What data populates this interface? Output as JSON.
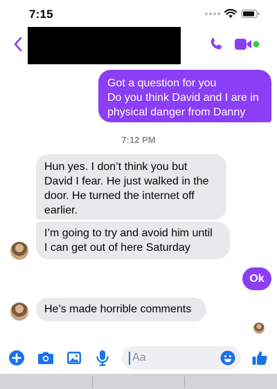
{
  "status_bar": {
    "time": "7:15"
  },
  "header": {
    "back_icon": "chevron-left-icon",
    "call_icon": "phone-icon",
    "video_icon": "video-camera-icon",
    "accent_color": "#8a3ef5",
    "online_color": "#31cc46"
  },
  "thread": {
    "outgoing_1": [
      "Got a question for you",
      "Do you think David and I are in",
      "physical danger from Danny"
    ],
    "timestamp": "7:12 PM",
    "incoming_1": [
      "Hun yes. I don’t think you but",
      "David I fear.  He just walked in the",
      "door. He turned the internet off",
      "earlier."
    ],
    "incoming_2": [
      "I’m going to try and avoid him until",
      "I can get out of here Saturday"
    ],
    "outgoing_2": "Ok",
    "incoming_3": "He’s made horrible comments"
  },
  "composer": {
    "placeholder": "Aa",
    "icons": [
      "plus-icon",
      "camera-icon",
      "photo-icon",
      "microphone-icon",
      "emoji-icon",
      "thumbs-up-icon"
    ]
  },
  "colors": {
    "outgoing_bubble": "#8a3ef5",
    "incoming_bubble": "#e9e9eb",
    "icon_blue": "#1a73e8"
  }
}
